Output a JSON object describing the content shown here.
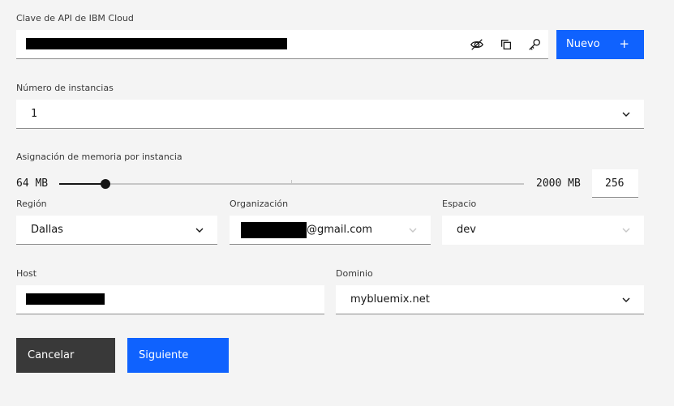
{
  "api_key": {
    "label": "Clave de API de IBM Cloud",
    "new_button": "Nuevo",
    "new_button_icon": "+",
    "icons": [
      "eye-slash-icon",
      "copy-icon",
      "key-icon"
    ]
  },
  "instances": {
    "label": "Número de instancias",
    "value": "1"
  },
  "memory": {
    "label": "Asignación de memoria por instancia",
    "min_label": "64 MB",
    "max_label": "2000 MB",
    "value": "256",
    "min": 64,
    "max": 2000,
    "current": 256
  },
  "region": {
    "label": "Región",
    "value": "Dallas"
  },
  "organization": {
    "label": "Organización",
    "value_suffix": "@gmail.com"
  },
  "space": {
    "label": "Espacio",
    "value": "dev"
  },
  "host": {
    "label": "Host"
  },
  "domain": {
    "label": "Dominio",
    "value": "mybluemix.net"
  },
  "actions": {
    "cancel": "Cancelar",
    "next": "Siguiente"
  },
  "colors": {
    "primary": "#0f62fe",
    "secondary": "#393939",
    "background": "#f4f4f4"
  }
}
